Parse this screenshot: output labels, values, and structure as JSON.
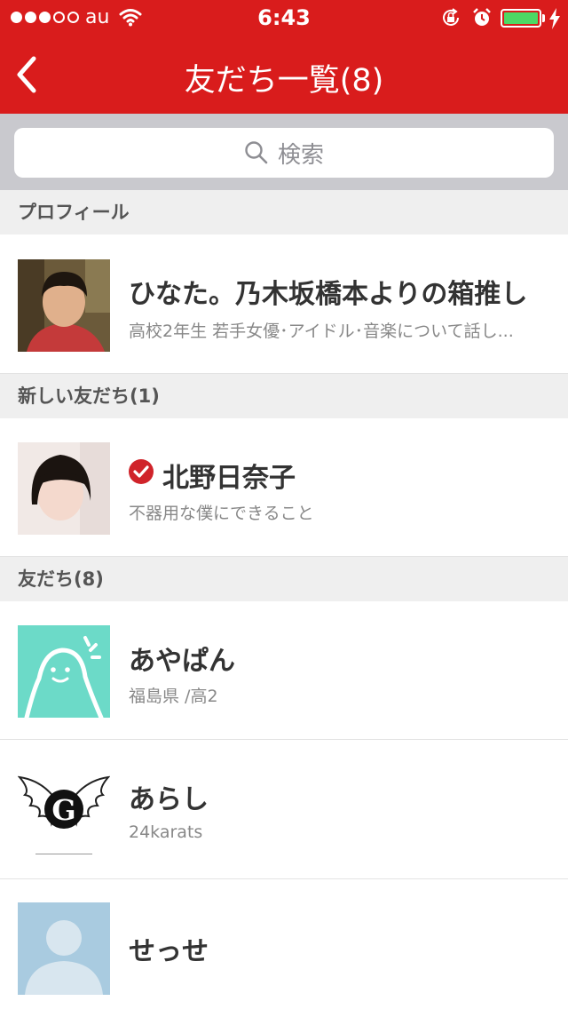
{
  "status_bar": {
    "carrier": "au",
    "time": "6:43",
    "signal_bars_filled": 3,
    "signal_bars_total": 5,
    "battery_level": 1.0,
    "icons": [
      "wifi-icon",
      "rotation-lock-icon",
      "alarm-icon",
      "battery-icon",
      "charging-bolt-icon"
    ]
  },
  "nav": {
    "back_icon": "chevron-left-icon",
    "title": "友だち一覧(8)"
  },
  "search": {
    "placeholder": "検索",
    "icon": "search-icon"
  },
  "sections": {
    "profile": {
      "label": "プロフィール"
    },
    "new_friends": {
      "label": "新しい友だち(1)"
    },
    "friends": {
      "label": "友だち(8)"
    }
  },
  "profile": {
    "name": "ひなた。乃木坂橋本よりの箱推し",
    "description": "高校2年生 若手女優･アイドル･音楽について話し..."
  },
  "new_friends": [
    {
      "name": "北野日奈子",
      "description": "不器用な僕にできること",
      "verified": true
    }
  ],
  "friends": [
    {
      "name": "あやぱん",
      "description": "福島県 /高2"
    },
    {
      "name": "あらし",
      "description": "24karats"
    },
    {
      "name": "せっせ",
      "description": ""
    }
  ],
  "colors": {
    "header_red": "#d91c1c",
    "battery_green": "#4cd964",
    "verified_red": "#d0232a",
    "avatar_mint": "#6cdac8",
    "avatar_silhouette_blue": "#a9cbe0"
  }
}
